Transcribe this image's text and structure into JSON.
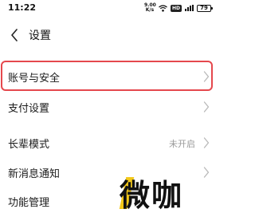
{
  "status_bar": {
    "time": "11:22",
    "speed_top": "9.00",
    "speed_bottom": "K/s",
    "network_badge": "HD",
    "battery": "79"
  },
  "header": {
    "back_icon": "chevron-left-icon",
    "title": "设置"
  },
  "menu": {
    "items": [
      {
        "label": "账号与安全",
        "value": "",
        "highlighted": true
      },
      {
        "label": "支付设置",
        "value": ""
      },
      {
        "label": "长辈模式",
        "value": "未开启"
      },
      {
        "label": "新消息通知",
        "value": ""
      },
      {
        "label": "功能管理",
        "value": ""
      }
    ]
  },
  "watermark": {
    "text": "微咖"
  },
  "colors": {
    "highlight_border": "#e5484d",
    "chevron": "#b8b8b8",
    "secondary_text": "#9a9a9a",
    "watermark_accent": "#f2c200"
  }
}
